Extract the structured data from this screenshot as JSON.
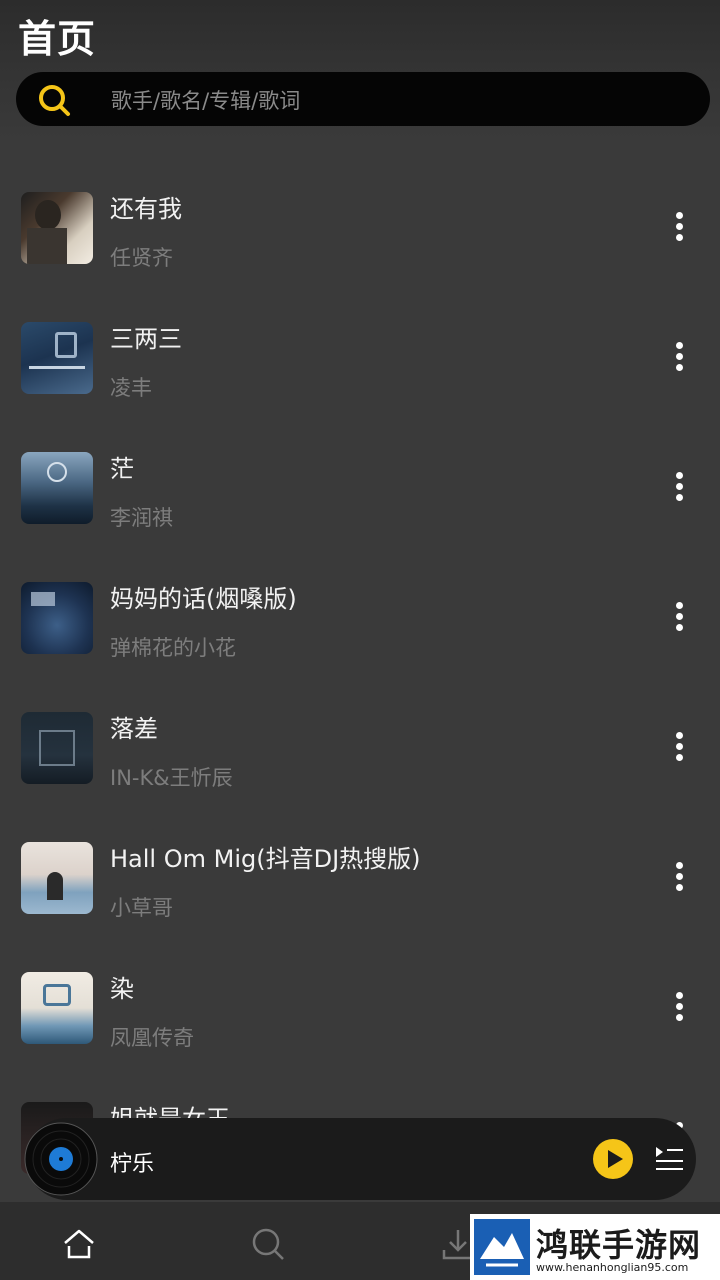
{
  "header": {
    "title": "首页",
    "search_placeholder": "歌手/歌名/专辑/歌词"
  },
  "songs": [
    {
      "title": "还有我",
      "artist": "任贤齐"
    },
    {
      "title": "三两三",
      "artist": "凌丰"
    },
    {
      "title": "茫",
      "artist": "李润祺"
    },
    {
      "title": "妈妈的话(烟嗓版)",
      "artist": "弹棉花的小花"
    },
    {
      "title": "落差",
      "artist": "IN-K&王忻辰"
    },
    {
      "title": "Hall Om Mig(抖音DJ热搜版)",
      "artist": "小草哥"
    },
    {
      "title": "染",
      "artist": "凤凰传奇"
    },
    {
      "title": "姐就是女王",
      "artist": ""
    }
  ],
  "player": {
    "now_playing": "柠乐"
  },
  "nav": {
    "items": [
      "home-icon",
      "search-icon",
      "download-icon"
    ]
  },
  "watermark": {
    "title": "鸿联手游网",
    "url": "www.henanhonglian95.com"
  },
  "colors": {
    "accent": "#f5c518",
    "background": "#3a3a3a",
    "search_bg": "#050505",
    "artist_text": "#7d7d7d"
  }
}
